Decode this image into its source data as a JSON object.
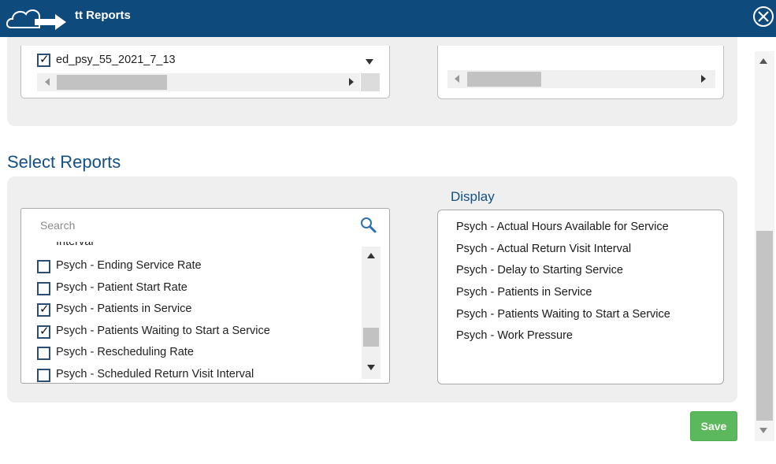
{
  "header": {
    "title": "tt Reports",
    "logo_icon": "cloud-arrow-logo",
    "close_icon": "close-circle-icon",
    "background": "#0f4a7c"
  },
  "datasets": {
    "selected_item": {
      "label": "ed_psy_55_2021_7_13",
      "checked": true
    }
  },
  "section": {
    "title": "Select Reports"
  },
  "reports": {
    "search_placeholder": "Search",
    "items": [
      {
        "label": "Interval",
        "checked": false,
        "partial": true
      },
      {
        "label": "Psych - Ending Service Rate",
        "checked": false
      },
      {
        "label": "Psych - Patient Start Rate",
        "checked": false
      },
      {
        "label": "Psych - Patients in Service",
        "checked": true
      },
      {
        "label": "Psych - Patients Waiting to Start a Service",
        "checked": true
      },
      {
        "label": "Psych - Rescheduling Rate",
        "checked": false
      },
      {
        "label": "Psych - Scheduled Return Visit Interval",
        "checked": false
      }
    ]
  },
  "display": {
    "label": "Display",
    "items": [
      "Psych - Actual Hours Available for Service",
      "Psych - Actual Return Visit Interval",
      "Psych - Delay to Starting Service",
      "Psych - Patients in Service",
      "Psych - Patients Waiting to Start a Service",
      "Psych - Work Pressure"
    ]
  },
  "actions": {
    "save_label": "Save",
    "save_color": "#5cb85c"
  }
}
